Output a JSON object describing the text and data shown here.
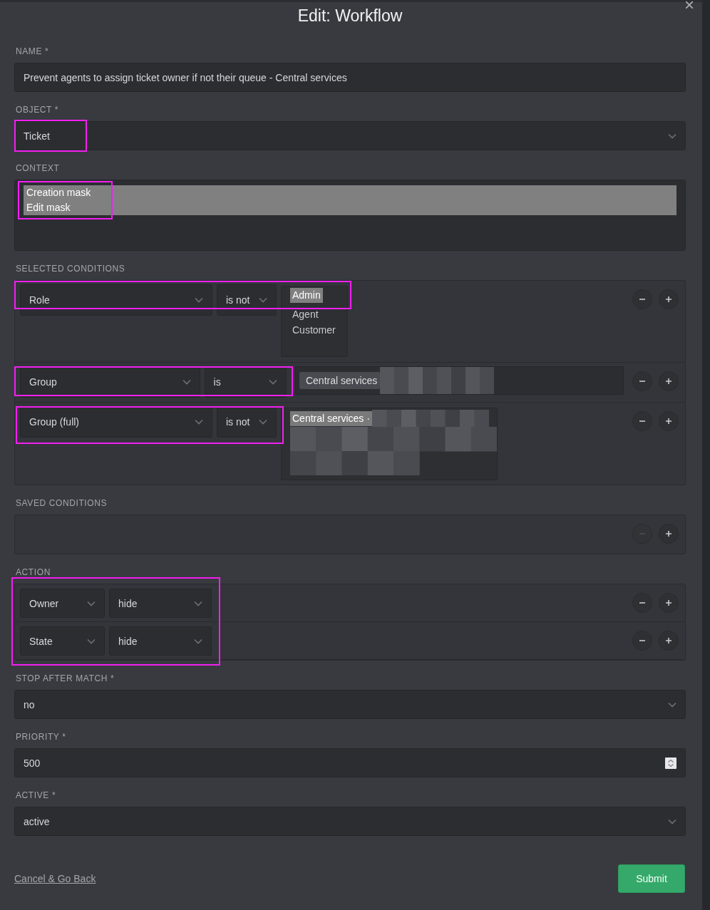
{
  "dialog": {
    "title": "Edit: Workflow",
    "close": "×"
  },
  "name": {
    "label": "NAME *",
    "value": "Prevent agents to assign ticket owner if not their queue - Central services"
  },
  "object": {
    "label": "OBJECT *",
    "value": "Ticket",
    "annotated": true
  },
  "context": {
    "label": "CONTEXT",
    "annotated": true,
    "options": [
      {
        "label": "Creation mask",
        "selected": true
      },
      {
        "label": "Edit mask",
        "selected": true
      }
    ]
  },
  "selected_conditions": {
    "label": "SELECTED CONDITIONS",
    "rows": [
      {
        "attribute": "Role",
        "operator": "is not",
        "kind": "listbox",
        "annotated": true,
        "remove_disabled": false,
        "redacted": false,
        "options": [
          {
            "label": "Admin",
            "selected": true
          },
          {
            "label": "Agent",
            "selected": false
          },
          {
            "label": "Customer",
            "selected": false
          }
        ]
      },
      {
        "attribute": "Group",
        "operator": "is",
        "kind": "tokens",
        "annotated": true,
        "remove_disabled": false,
        "redacted": true,
        "tokens": [
          "Central services"
        ]
      },
      {
        "attribute": "Group (full)",
        "operator": "is not",
        "kind": "listbox",
        "annotated": true,
        "remove_disabled": false,
        "redacted": true,
        "options": [
          {
            "label": "Central services ·",
            "selected": true
          }
        ]
      }
    ]
  },
  "saved_conditions": {
    "label": "SAVED CONDITIONS",
    "remove_disabled": true
  },
  "action": {
    "label": "ACTION",
    "annotated": true,
    "rows": [
      {
        "attribute": "Owner",
        "operation": "hide",
        "remove_disabled": false
      },
      {
        "attribute": "State",
        "operation": "hide",
        "remove_disabled": false
      }
    ]
  },
  "stop_after_match": {
    "label": "STOP AFTER MATCH *",
    "value": "no"
  },
  "priority": {
    "label": "PRIORITY *",
    "value": "500"
  },
  "active": {
    "label": "ACTIVE *",
    "value": "active"
  },
  "footer": {
    "cancel": "Cancel & Go Back",
    "submit": "Submit"
  }
}
